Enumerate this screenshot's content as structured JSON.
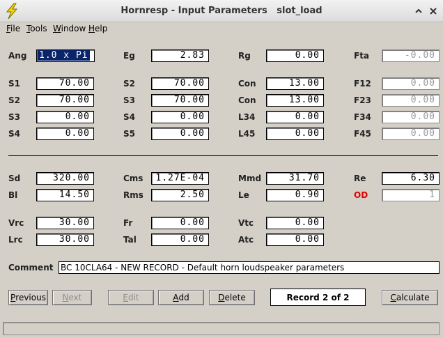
{
  "window": {
    "title": "Hornresp - Input Parameters   slot_load",
    "colors": {
      "chrome": "#d4d0c8",
      "title_text": "#333333",
      "selection": "#0a246a",
      "od_label": "#e00000",
      "disabled_text": "#9a9a9a"
    }
  },
  "icons": {
    "app": "lightning-bolt-icon",
    "maximize": "chevron-up-icon",
    "close": "close-icon"
  },
  "menu": {
    "file": {
      "ul": "F",
      "rest": "ile"
    },
    "tools": {
      "ul": "T",
      "rest": "ools"
    },
    "window": {
      "ul": "W",
      "rest": "indow"
    },
    "help": {
      "ul": "H",
      "rest": "elp"
    }
  },
  "horn": {
    "ang": {
      "label": "Ang",
      "value": "1.0 x Pi"
    },
    "eg": {
      "label": "Eg",
      "value": "2.83"
    },
    "rg": {
      "label": "Rg",
      "value": "0.00"
    },
    "fta": {
      "label": "Fta",
      "value": "-0.00"
    },
    "s1": {
      "label": "S1",
      "value": "70.00"
    },
    "s2a": {
      "label": "S2",
      "value": "70.00"
    },
    "con1": {
      "label": "Con",
      "value": "13.00"
    },
    "f12": {
      "label": "F12",
      "value": "0.00"
    },
    "s2b": {
      "label": "S2",
      "value": "70.00"
    },
    "s3a": {
      "label": "S3",
      "value": "70.00"
    },
    "con2": {
      "label": "Con",
      "value": "13.00"
    },
    "f23": {
      "label": "F23",
      "value": "0.00"
    },
    "s3b": {
      "label": "S3",
      "value": "0.00"
    },
    "s4a": {
      "label": "S4",
      "value": "0.00"
    },
    "l34": {
      "label": "L34",
      "value": "0.00"
    },
    "f34": {
      "label": "F34",
      "value": "0.00"
    },
    "s4b": {
      "label": "S4",
      "value": "0.00"
    },
    "s5": {
      "label": "S5",
      "value": "0.00"
    },
    "l45": {
      "label": "L45",
      "value": "0.00"
    },
    "f45": {
      "label": "F45",
      "value": "0.00"
    }
  },
  "driver": {
    "sd": {
      "label": "Sd",
      "value": "320.00"
    },
    "cms": {
      "label": "Cms",
      "value": "1.27E-04"
    },
    "mmd": {
      "label": "Mmd",
      "value": "31.70"
    },
    "re": {
      "label": "Re",
      "value": "6.30"
    },
    "bl": {
      "label": "Bl",
      "value": "14.50"
    },
    "rms": {
      "label": "Rms",
      "value": "2.50"
    },
    "le": {
      "label": "Le",
      "value": "0.90"
    },
    "od": {
      "label": "OD",
      "value": "1"
    }
  },
  "chamber": {
    "vrc": {
      "label": "Vrc",
      "value": "30.00"
    },
    "fr": {
      "label": "Fr",
      "value": "0.00"
    },
    "vtc": {
      "label": "Vtc",
      "value": "0.00"
    },
    "lrc": {
      "label": "Lrc",
      "value": "30.00"
    },
    "tal": {
      "label": "Tal",
      "value": "0.00"
    },
    "atc": {
      "label": "Atc",
      "value": "0.00"
    }
  },
  "comment": {
    "label": "Comment",
    "value": "BC 10CLA64 - NEW RECORD - Default horn loudspeaker parameters"
  },
  "buttons": {
    "previous": {
      "ul": "P",
      "rest": "revious"
    },
    "next": {
      "ul": "N",
      "rest": "ext"
    },
    "edit": {
      "ul": "E",
      "rest": "dit"
    },
    "add": {
      "ul": "A",
      "rest": "dd"
    },
    "delete": {
      "ul": "D",
      "rest": "elete"
    },
    "calculate": {
      "ul": "C",
      "rest": "alculate"
    }
  },
  "record": "Record 2 of 2"
}
